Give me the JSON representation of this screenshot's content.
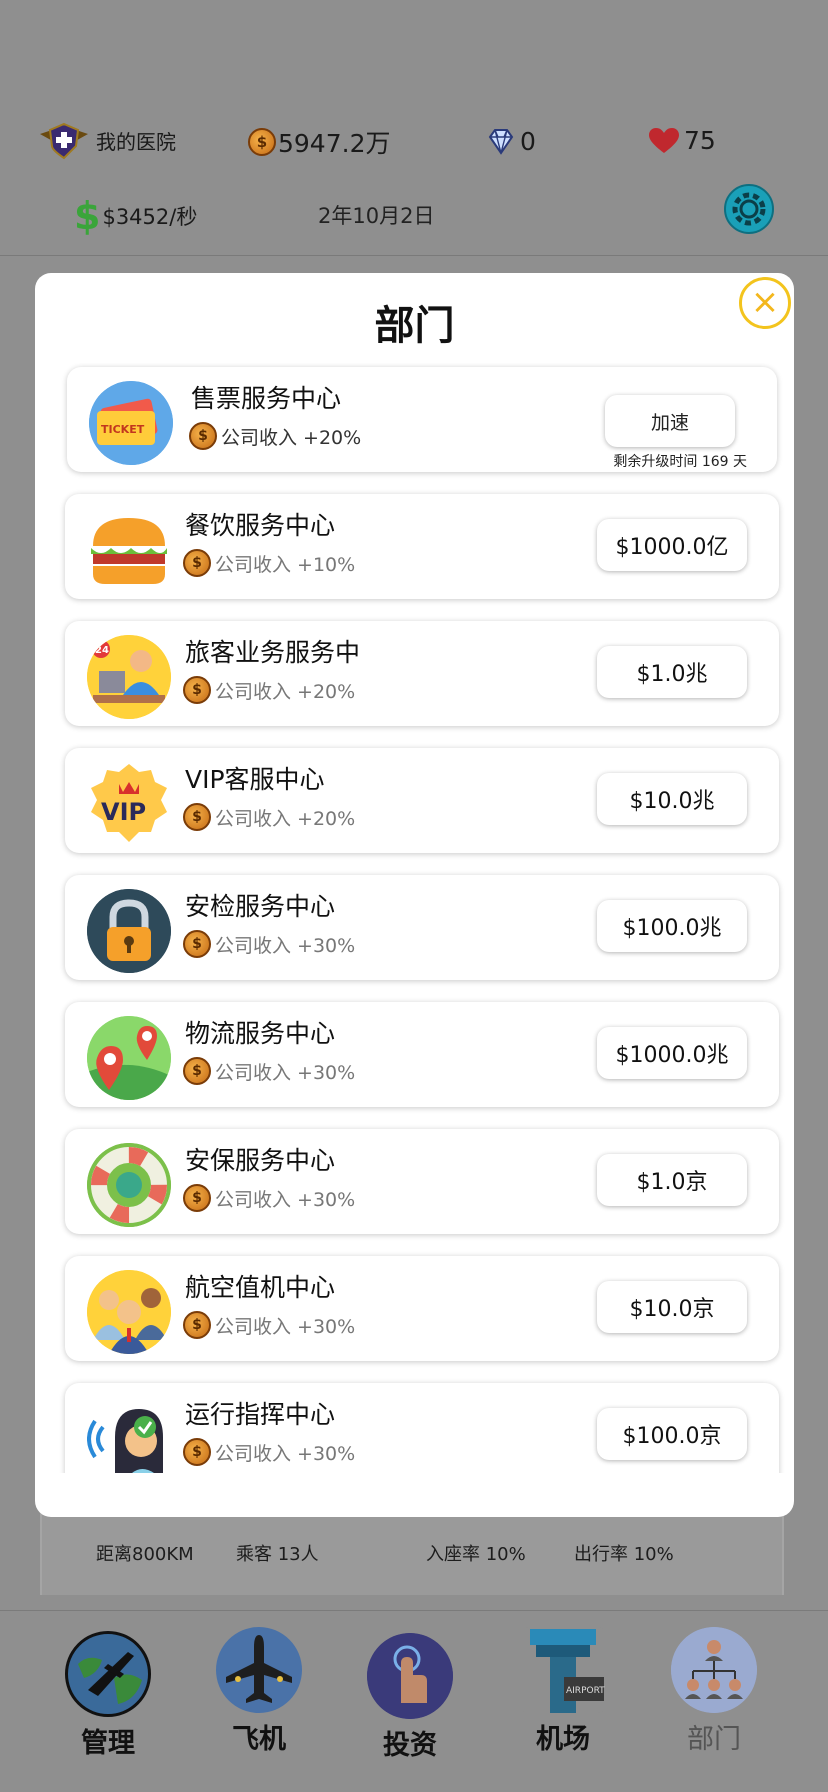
{
  "status_bar": {
    "hospital_label": "我的医院",
    "coins": "5947.2万",
    "diamonds": "0",
    "hearts": "75",
    "income_rate": "$3452/秒",
    "date": "2年10月2日"
  },
  "modal": {
    "title": "部门",
    "close_symbol": "×",
    "departments": [
      {
        "name": "售票服务中心",
        "income": "公司收入 +20%",
        "action": "加速",
        "remaining": "剩余升级时间 169 天",
        "icon": "ticket-icon"
      },
      {
        "name": "餐饮服务中心",
        "income": "公司收入 +10%",
        "price": "$1000.0亿",
        "icon": "burger-icon"
      },
      {
        "name": "旅客业务服务中",
        "income": "公司收入 +20%",
        "price": "$1.0兆",
        "icon": "customer-service-icon"
      },
      {
        "name": "VIP客服中心",
        "income": "公司收入 +20%",
        "price": "$10.0兆",
        "icon": "vip-badge-icon"
      },
      {
        "name": "安检服务中心",
        "income": "公司收入 +30%",
        "price": "$100.0兆",
        "icon": "padlock-icon"
      },
      {
        "name": "物流服务中心",
        "income": "公司收入 +30%",
        "price": "$1000.0兆",
        "icon": "map-pin-icon"
      },
      {
        "name": "安保服务中心",
        "income": "公司收入 +30%",
        "price": "$1.0京",
        "icon": "lifebuoy-icon"
      },
      {
        "name": "航空值机中心",
        "income": "公司收入 +30%",
        "price": "$10.0京",
        "icon": "staff-group-icon"
      },
      {
        "name": "运行指挥中心",
        "income": "公司收入 +30%",
        "price": "$100.0京",
        "icon": "operator-headset-icon"
      }
    ]
  },
  "background_info": {
    "distance": "距离800KM",
    "passengers": "乘客 13人",
    "occupancy": "入座率 10%",
    "travel_rate": "出行率 10%"
  },
  "bottom_nav": [
    {
      "label": "管理",
      "icon": "globe-plane-icon"
    },
    {
      "label": "飞机",
      "icon": "airplane-icon"
    },
    {
      "label": "投资",
      "icon": "finger-tap-icon"
    },
    {
      "label": "机场",
      "icon": "control-tower-icon"
    },
    {
      "label": "部门",
      "icon": "org-chart-icon"
    }
  ],
  "colors": {
    "overlay_gray": "#8f8f8f",
    "close_ring": "#f3c41d",
    "dollar_green": "#3aa53a",
    "settings_teal": "#1aa0b8"
  }
}
